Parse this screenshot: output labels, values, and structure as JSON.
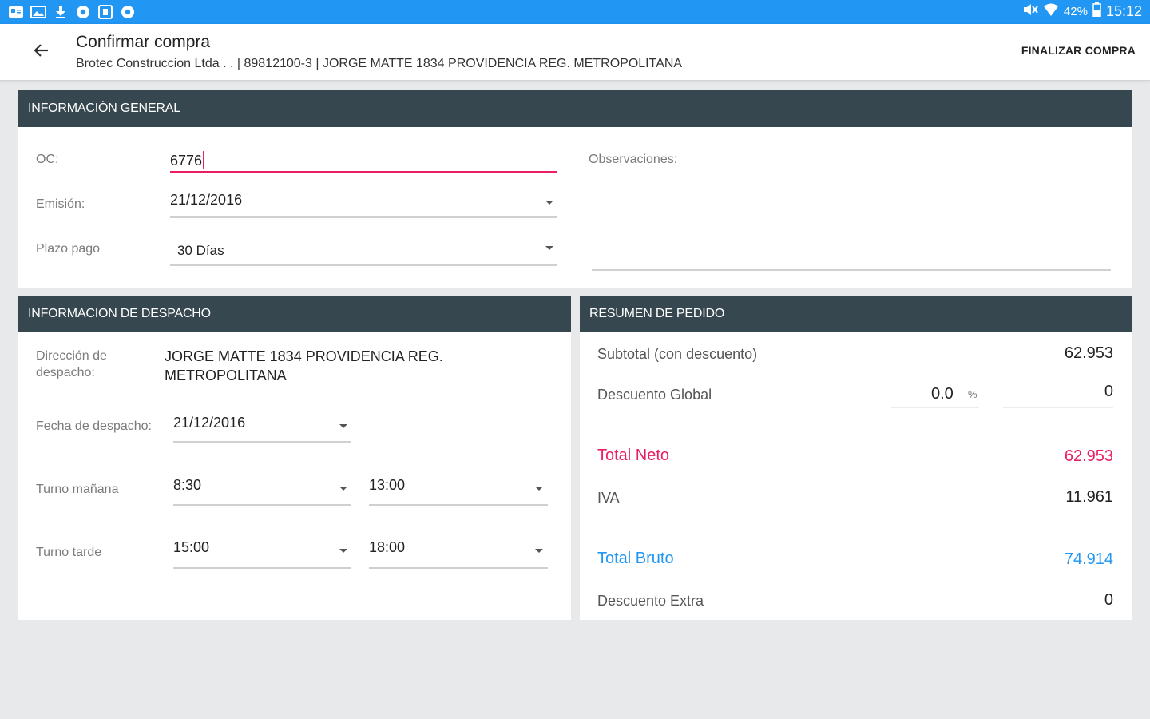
{
  "status_bar": {
    "left_icons": [
      "email-icon",
      "gallery-icon",
      "download-icon",
      "chrome-icon",
      "tablet-icon",
      "chrome-icon"
    ],
    "battery": "42%",
    "time": "15:12"
  },
  "app_bar": {
    "title": "Confirmar compra",
    "subtitle": "Brotec Construccion Ltda . .  | 89812100-3 | JORGE MATTE 1834  PROVIDENCIA  REG. METROPOLITANA",
    "action": "FINALIZAR COMPRA"
  },
  "general": {
    "header": "INFORMACIÓN GENERAL",
    "oc_label": "OC:",
    "oc_value": "6776",
    "emision_label": "Emisión:",
    "emision_value": "21/12/2016",
    "plazo_label": "Plazo pago",
    "plazo_value": "30 Días",
    "obs_label": "Observaciones:"
  },
  "despacho": {
    "header": "INFORMACION DE DESPACHO",
    "direccion_label": "Dirección de despacho:",
    "direccion_value": "JORGE MATTE 1834  PROVIDENCIA  REG. METROPOLITANA",
    "fecha_label": "Fecha de despacho:",
    "fecha_value": "21/12/2016",
    "manana_label": "Turno mañana",
    "manana_from": "8:30",
    "manana_to": "13:00",
    "tarde_label": "Turno tarde",
    "tarde_from": "15:00",
    "tarde_to": "18:00"
  },
  "resumen": {
    "header": "RESUMEN DE PEDIDO",
    "subtotal_label": "Subtotal (con descuento)",
    "subtotal_value": "62.953",
    "descuento_label": "Descuento Global",
    "descuento_pct": "0.0",
    "pct_symbol": "%",
    "descuento_value": "0",
    "neto_label": "Total Neto",
    "neto_value": "62.953",
    "iva_label": "IVA",
    "iva_value": "11.961",
    "bruto_label": "Total Bruto",
    "bruto_value": "74.914",
    "extra_label": "Descuento Extra",
    "extra_value": "0"
  },
  "colors": {
    "status_bar": "#2196f3",
    "card_header": "#37474f",
    "accent_pink": "#e91e63",
    "accent_blue": "#2196f3"
  }
}
